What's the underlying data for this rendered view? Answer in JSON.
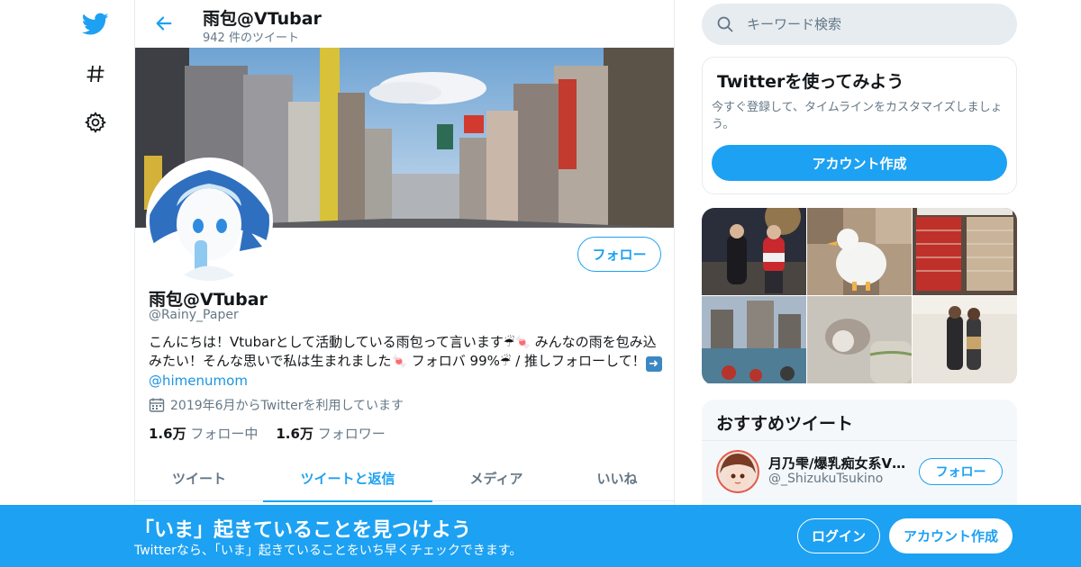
{
  "nav": {
    "items": [
      {
        "icon": "twitter-bird-icon"
      },
      {
        "icon": "hashtag-icon"
      },
      {
        "icon": "gear-icon"
      }
    ]
  },
  "header": {
    "title": "雨包@VTubar",
    "tweet_count": "942 件のツイート"
  },
  "profile": {
    "name": "雨包@VTubar",
    "handle": "@Rainy_Paper",
    "follow_label": "フォロー",
    "bio_part1": "こんにちは！Vtubarとして活動している雨包って言います",
    "bio_part2": " みんなの雨を包み込みたい！そんな思いで私は生まれました",
    "bio_part3": " フォロバ 99%",
    "bio_part4": "  /  推しフォローして！",
    "bio_link": "@himenumom",
    "joined": "2019年6月からTwitterを利用しています",
    "following_count": "1.6万",
    "following_label": "フォロー中",
    "followers_count": "1.6万",
    "followers_label": "フォロワー"
  },
  "tabs": [
    {
      "label": "ツイート",
      "active": false
    },
    {
      "label": "ツイートと返信",
      "active": true
    },
    {
      "label": "メディア",
      "active": false
    },
    {
      "label": "いいね",
      "active": false
    }
  ],
  "search": {
    "placeholder": "キーワード検索"
  },
  "signup_card": {
    "title": "Twitterを使ってみよう",
    "text": "今すぐ登録して、タイムラインをカスタマイズしましょう。",
    "button": "アカウント作成"
  },
  "recommended": {
    "title": "おすすめツイート",
    "user_name": "月乃雫/爆乳痴女系VTuber",
    "user_handle": "@_ShizukuTsukino",
    "follow_label": "フォロー"
  },
  "bottom_bar": {
    "title": "「いま」起きていることを見つけよう",
    "subtitle": "Twitterなら、「いま」起きていることをいち早くチェックできます。",
    "login": "ログイン",
    "signup": "アカウント作成"
  },
  "colors": {
    "accent": "#1da1f2",
    "secondary_text": "#657786",
    "border": "#e6ecf0"
  }
}
